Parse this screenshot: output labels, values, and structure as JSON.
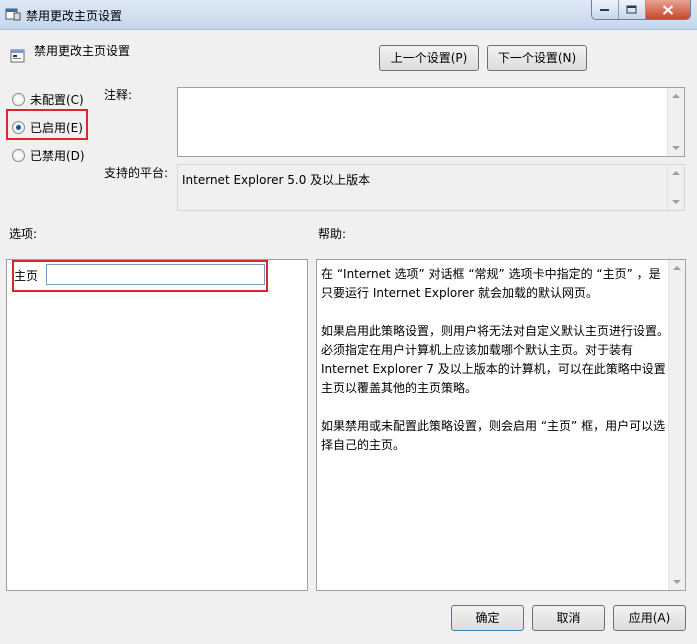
{
  "window": {
    "title": "禁用更改主页设置",
    "icon": "policy-setting-icon"
  },
  "header": {
    "policy_name": "禁用更改主页设置",
    "prev_button": "上一个设置(P)",
    "next_button": "下一个设置(N)"
  },
  "state": {
    "options": [
      {
        "label": "未配置(C)",
        "checked": false
      },
      {
        "label": "已启用(E)",
        "checked": true
      },
      {
        "label": "已禁用(D)",
        "checked": false
      }
    ]
  },
  "comment": {
    "label": "注释:",
    "value": ""
  },
  "platform": {
    "label": "支持的平台:",
    "value": "Internet Explorer 5.0 及以上版本"
  },
  "options_panel": {
    "label": "选项:",
    "homepage_label": "主页",
    "homepage_value": ""
  },
  "help_panel": {
    "label": "帮助:",
    "paragraphs": [
      "在 “Internet 选项” 对话框 “常规” 选项卡中指定的 “主页” ，是只要运行 Internet Explorer 就会加载的默认网页。",
      "如果启用此策略设置，则用户将无法对自定义默认主页进行设置。必须指定在用户计算机上应该加载哪个默认主页。对于装有 Internet Explorer 7 及以上版本的计算机，可以在此策略中设置主页以覆盖其他的主页策略。",
      "如果禁用或未配置此策略设置，则会启用 “主页” 框，用户可以选择自己的主页。"
    ]
  },
  "footer": {
    "ok": "确定",
    "cancel": "取消",
    "apply": "应用(A)"
  },
  "colors": {
    "highlight": "#e0242d",
    "titlebar": "#c5d6ec",
    "close_button": "#c7462a"
  }
}
